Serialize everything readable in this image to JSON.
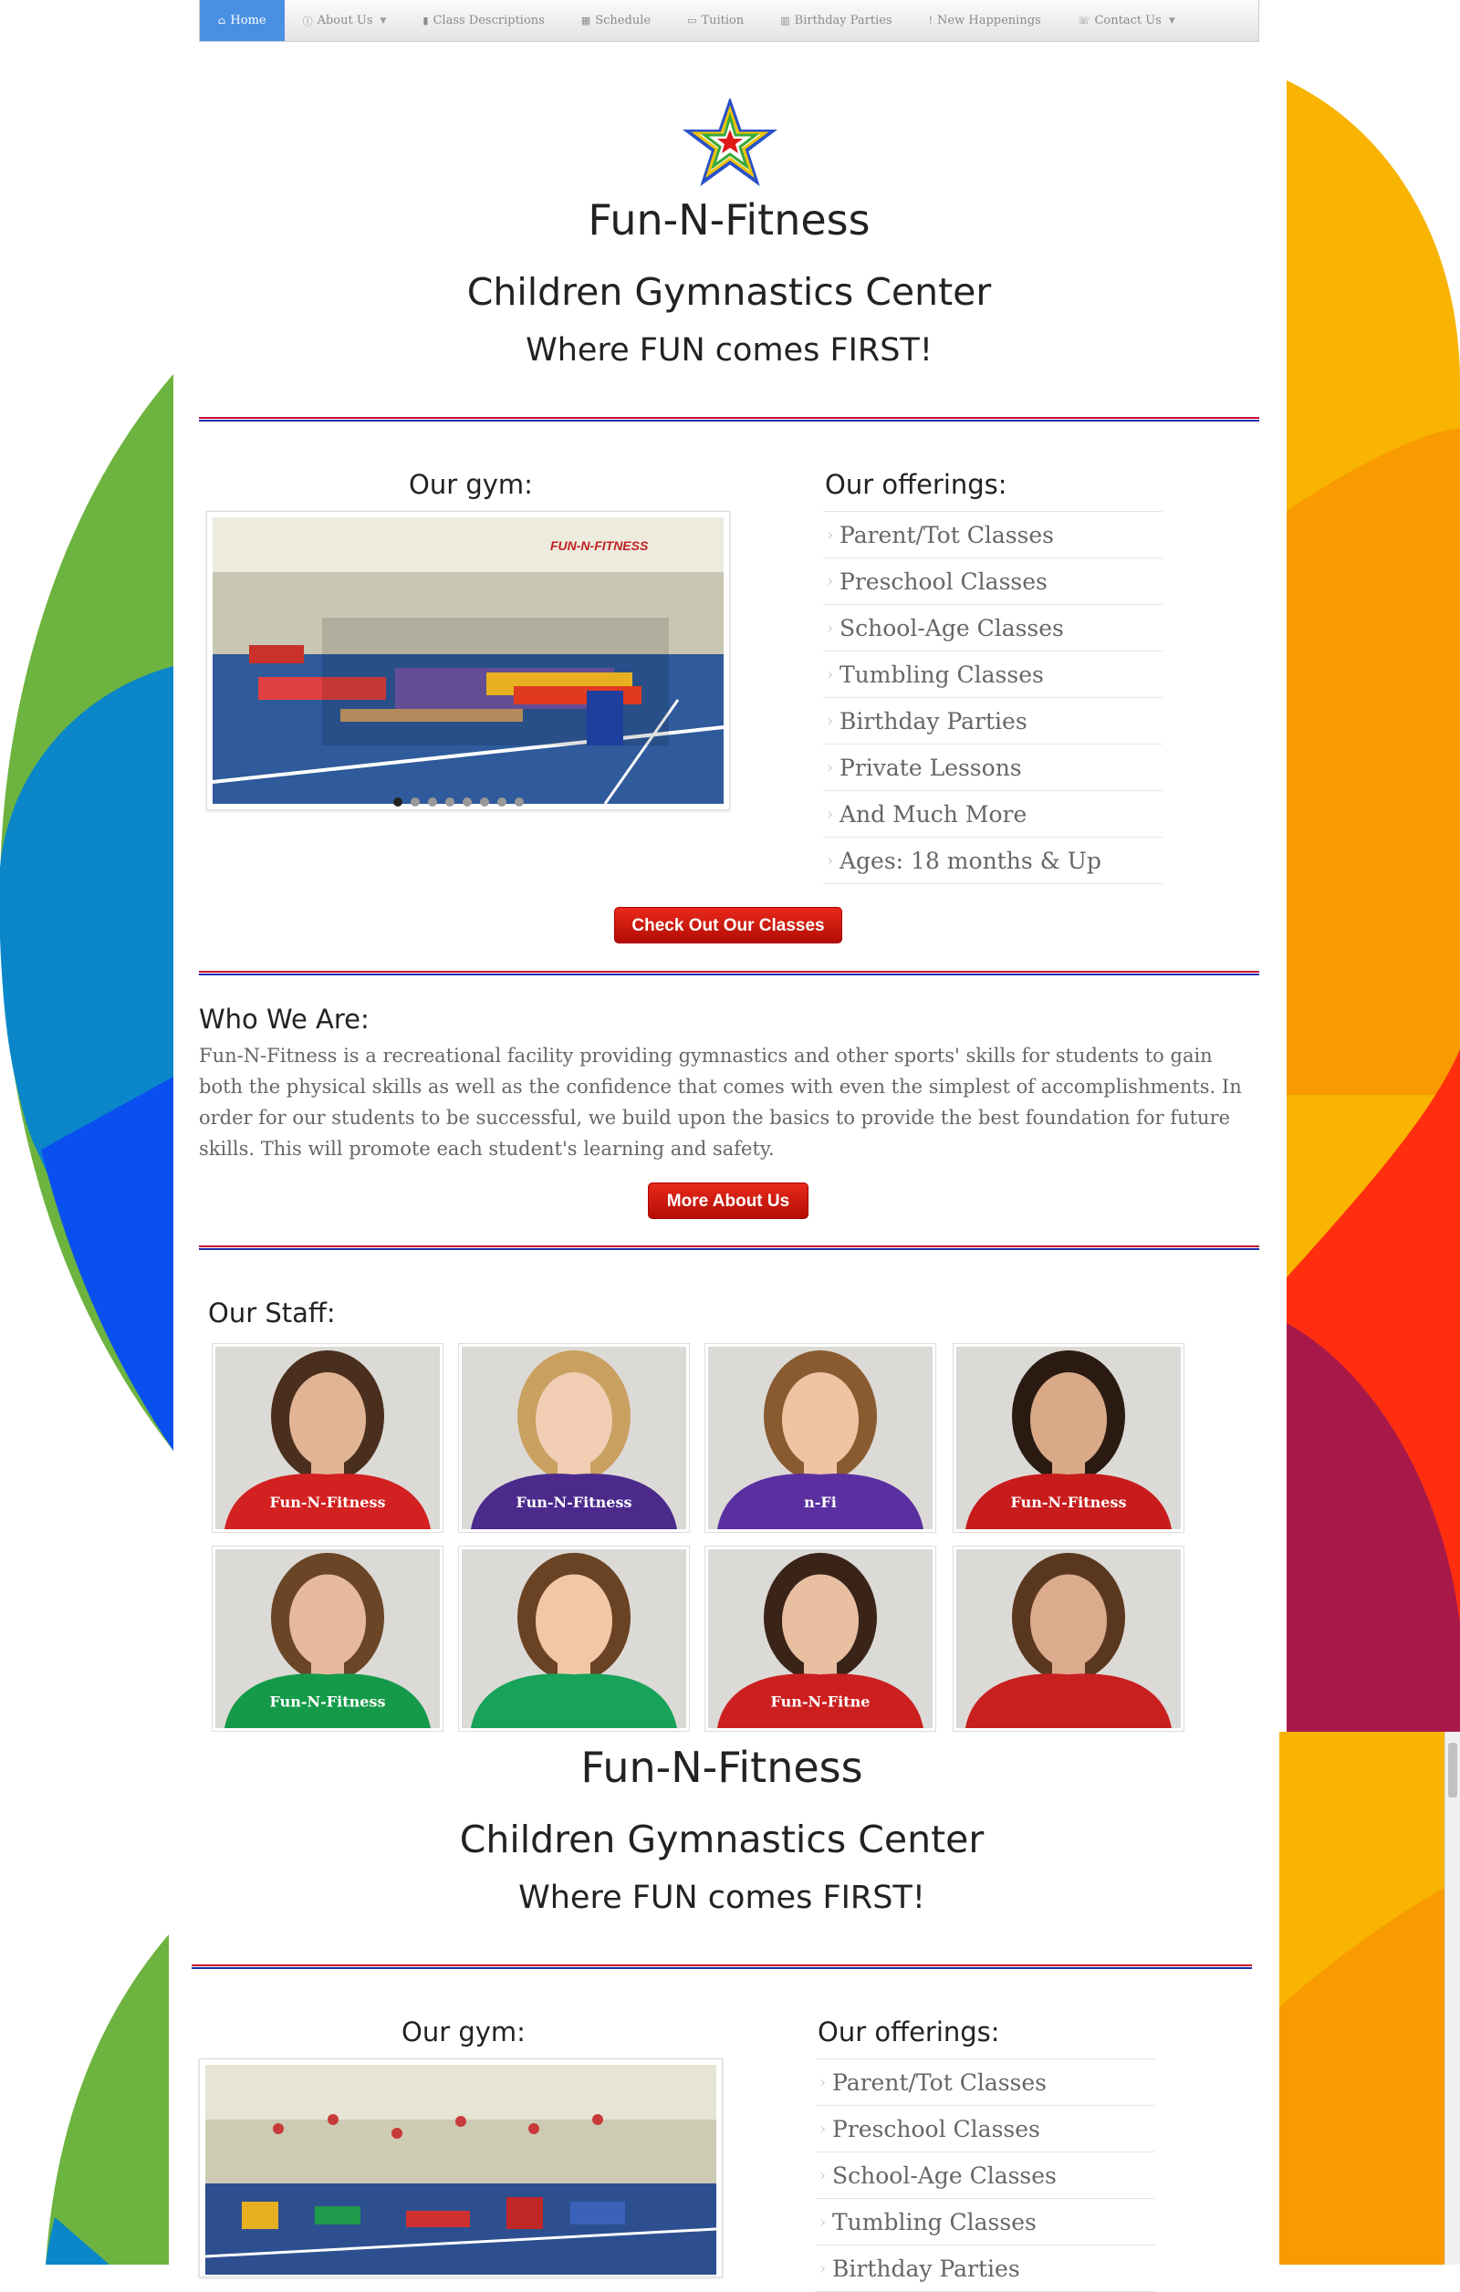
{
  "nav": {
    "items": [
      {
        "label": "Home",
        "icon": "home-icon",
        "active": true,
        "dropdown": false
      },
      {
        "label": "About Us",
        "icon": "info-icon",
        "active": false,
        "dropdown": true
      },
      {
        "label": "Class Descriptions",
        "icon": "book-icon",
        "active": false,
        "dropdown": false
      },
      {
        "label": "Schedule",
        "icon": "calendar-icon",
        "active": false,
        "dropdown": false
      },
      {
        "label": "Tuition",
        "icon": "money-icon",
        "active": false,
        "dropdown": false
      },
      {
        "label": "Birthday Parties",
        "icon": "people-icon",
        "active": false,
        "dropdown": false
      },
      {
        "label": "New Happenings",
        "icon": "exclamation-icon",
        "active": false,
        "dropdown": false
      },
      {
        "label": "Contact Us",
        "icon": "phone-icon",
        "active": false,
        "dropdown": true
      }
    ]
  },
  "header": {
    "title": "Fun-N-Fitness",
    "subtitle": "Children Gymnastics Center",
    "tagline": "Where FUN comes FIRST!"
  },
  "gym": {
    "title": "Our gym:",
    "slide_count": 8,
    "active_slide": 1
  },
  "offerings": {
    "title": "Our offerings:",
    "items": [
      "Parent/Tot Classes",
      "Preschool Classes",
      "School-Age Classes",
      "Tumbling Classes",
      "Birthday Parties",
      "Private Lessons",
      "And Much More",
      "Ages: 18 months & Up"
    ]
  },
  "classes_button": "Check Out Our Classes",
  "who": {
    "title": "Who We Are:",
    "text": "Fun-N-Fitness is a recreational facility providing gymnastics and other sports' skills for students to gain both the physical skills as well as the confidence that comes with even the simplest of accomplishments. In order for our students to be successful, we build upon the basics to provide the best foundation for future skills. This will promote each student's learning and safety.",
    "button": "More About Us"
  },
  "staff": {
    "title": "Our Staff:",
    "shirts": [
      "#d32020",
      "#4b2a8c",
      "#5a2fa0",
      "#c81c1c",
      "#159a4a",
      "#18a35a",
      "#cc1f1f",
      "#c81f1f"
    ],
    "shirt_texts": [
      "Fun-N-Fitness",
      "Fun-N-Fitness",
      "n-Fi",
      "Fun-N-Fitness",
      "Fun-N-Fitness",
      "",
      "Fun-N-Fitne",
      ""
    ]
  },
  "repeat_header": {
    "title": "Fun-N-Fitness",
    "subtitle": "Children Gymnastics Center",
    "tagline": "Where FUN comes FIRST!"
  },
  "repeat_gym": {
    "title": "Our gym:"
  },
  "repeat_offerings": {
    "title": "Our offerings:",
    "items": [
      "Parent/Tot Classes",
      "Preschool Classes",
      "School-Age Classes",
      "Tumbling Classes",
      "Birthday Parties"
    ]
  },
  "gym_sign": "FUN-N-FITNESS",
  "colors": {
    "rule_red": "#c8102e",
    "rule_blue": "#1c2fb0",
    "button_red": "#d01a10",
    "nav_active": "#4a90e2"
  }
}
